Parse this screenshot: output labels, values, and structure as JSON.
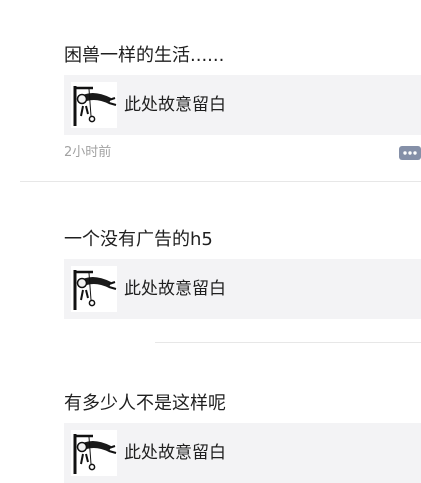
{
  "posts": [
    {
      "text": "困兽一样的生活......",
      "card": {
        "title": "此处故意留白",
        "thumbnail_icon": "hanging-figure-icon"
      },
      "timestamp": "2小时前",
      "comment_icon": "comment-icon"
    },
    {
      "text": "一个没有广告的h5",
      "card": {
        "title": "此处故意留白",
        "thumbnail_icon": "hanging-figure-icon"
      }
    },
    {
      "text": "有多少人不是这样呢",
      "card": {
        "title": "此处故意留白",
        "thumbnail_icon": "hanging-figure-icon"
      }
    }
  ],
  "colors": {
    "card_background": "#f3f3f5",
    "timestamp": "#a2a2a2",
    "comment_icon": "#8590a8",
    "divider": "#e7e7e7"
  }
}
